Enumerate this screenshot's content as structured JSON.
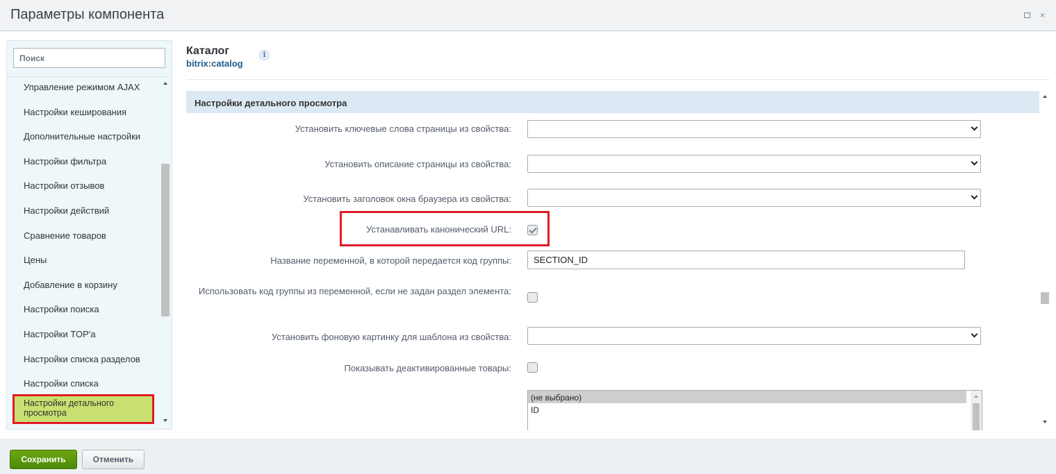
{
  "window": {
    "title": "Параметры компонента",
    "restore_icon": "restore-icon",
    "close_icon": "close-icon",
    "close_glyph": "×"
  },
  "sidebar": {
    "search_placeholder": "Поиск",
    "items": [
      {
        "label": "Управление режимом AJAX"
      },
      {
        "label": "Настройки кеширования"
      },
      {
        "label": "Дополнительные настройки"
      },
      {
        "label": "Настройки фильтра"
      },
      {
        "label": "Настройки отзывов"
      },
      {
        "label": "Настройки действий"
      },
      {
        "label": "Сравнение товаров"
      },
      {
        "label": "Цены"
      },
      {
        "label": "Добавление в корзину"
      },
      {
        "label": "Настройки поиска"
      },
      {
        "label": "Настройки TOP'а"
      },
      {
        "label": "Настройки списка разделов"
      },
      {
        "label": "Настройки списка"
      }
    ],
    "active_item": "Настройки детального просмотра"
  },
  "component": {
    "name": "Каталог",
    "code": "bitrix:catalog",
    "info_glyph": "i"
  },
  "section": {
    "title": "Настройки детального просмотра",
    "rows": {
      "keywords_label": "Установить ключевые слова страницы из свойства:",
      "keywords_value": "",
      "description_label": "Установить описание страницы из свойства:",
      "description_value": "",
      "browser_title_label": "Установить заголовок окна браузера из свойства:",
      "browser_title_value": "",
      "canonical_label": "Устанавливать канонический URL:",
      "canonical_checked": true,
      "section_var_label": "Название переменной, в которой передается код группы:",
      "section_var_value": "SECTION_ID",
      "use_group_code_label": "Использовать код группы из переменной, если не задан раздел элемента:",
      "use_group_code_checked": false,
      "background_label": "Установить фоновую картинку для шаблона из свойства:",
      "background_value": "",
      "show_deactivated_label": "Показывать деактивированные товары:",
      "show_deactivated_checked": false
    },
    "listbox_options": [
      "(не выбрано)",
      "ID"
    ]
  },
  "footer": {
    "save_label": "Сохранить",
    "cancel_label": "Отменить"
  },
  "colors": {
    "save_button": "#5a9a0c",
    "section_header": "#dce8f3",
    "active_item_bg": "#c9df6f",
    "highlight_border": "#e01b26"
  }
}
